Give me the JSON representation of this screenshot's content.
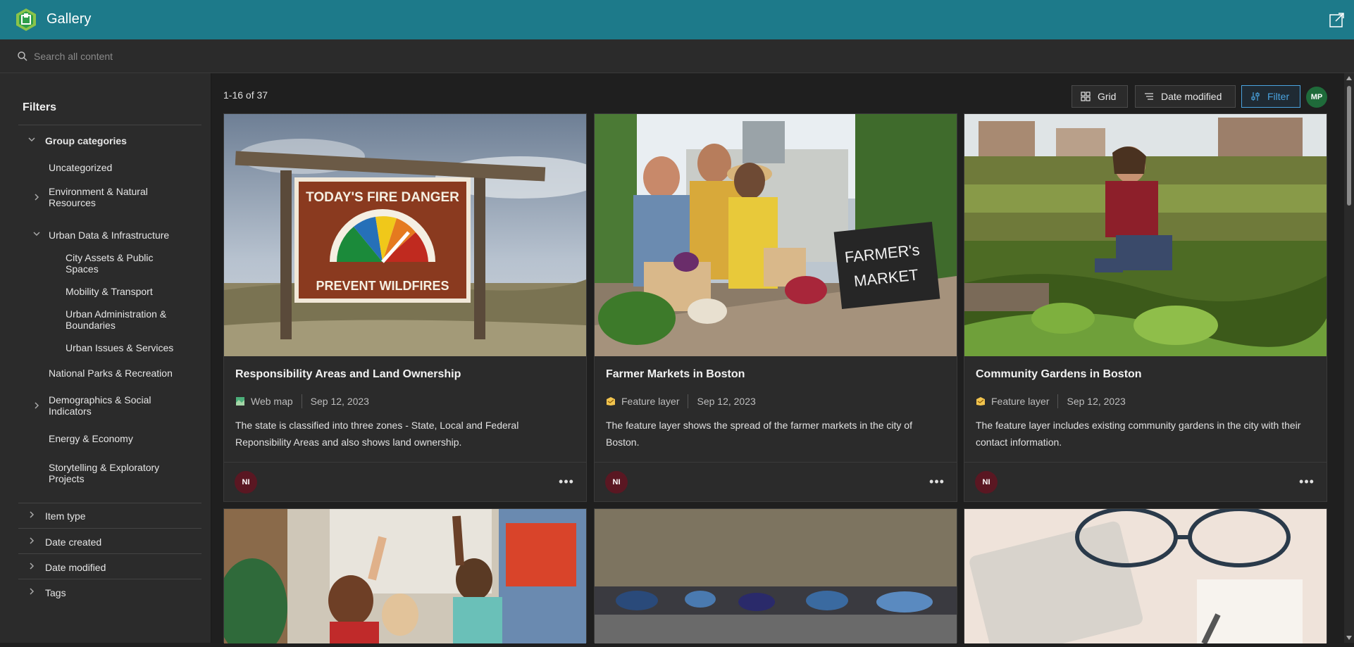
{
  "header": {
    "title": "Gallery"
  },
  "search": {
    "placeholder": "Search all content"
  },
  "sidebar": {
    "title": "Filters",
    "group_categories": {
      "label": "Group categories",
      "items": [
        {
          "label": "Uncategorized"
        },
        {
          "label": "Environment & Natural Resources"
        },
        {
          "label": "Urban Data & Infrastructure",
          "children": [
            {
              "label": "City Assets & Public Spaces"
            },
            {
              "label": "Mobility & Transport"
            },
            {
              "label": "Urban Administration & Boundaries"
            },
            {
              "label": "Urban Issues & Services"
            }
          ]
        },
        {
          "label": "National Parks & Recreation"
        },
        {
          "label": "Demographics & Social Indicators"
        },
        {
          "label": "Energy & Economy"
        },
        {
          "label": "Storytelling & Exploratory Projects"
        }
      ]
    },
    "sections": [
      {
        "label": "Item type"
      },
      {
        "label": "Date created"
      },
      {
        "label": "Date modified"
      },
      {
        "label": "Tags"
      }
    ]
  },
  "toolbar": {
    "count": "1-16 of 37",
    "grid_label": "Grid",
    "sort_label": "Date modified",
    "filter_label": "Filter",
    "user_initials": "MP"
  },
  "cards": [
    {
      "title": "Responsibility Areas and Land Ownership",
      "type": "Web map",
      "date": "Sep 12, 2023",
      "description": "The state is classified into three zones - State, Local and Federal Reponsibility Areas and also shows land ownership.",
      "owner": "NI",
      "sign_top": "TODAY'S FIRE DANGER",
      "sign_bottom": "PREVENT WILDFIRES"
    },
    {
      "title": "Farmer Markets in Boston",
      "type": "Feature layer",
      "date": "Sep 12, 2023",
      "description": "The feature layer shows the spread of the farmer markets in the city of Boston.",
      "owner": "NI",
      "sign_top": "FARMER's",
      "sign_bottom": "MARKET"
    },
    {
      "title": "Community Gardens in Boston",
      "type": "Feature layer",
      "date": "Sep 12, 2023",
      "description": "The feature layer includes existing community gardens in the city with their contact information.",
      "owner": "NI"
    }
  ],
  "colors": {
    "header_bg": "#1d7a8a",
    "accent": "#4aa3df",
    "owner_avatar": "#5a1722",
    "user_avatar": "#1f6b3a"
  }
}
